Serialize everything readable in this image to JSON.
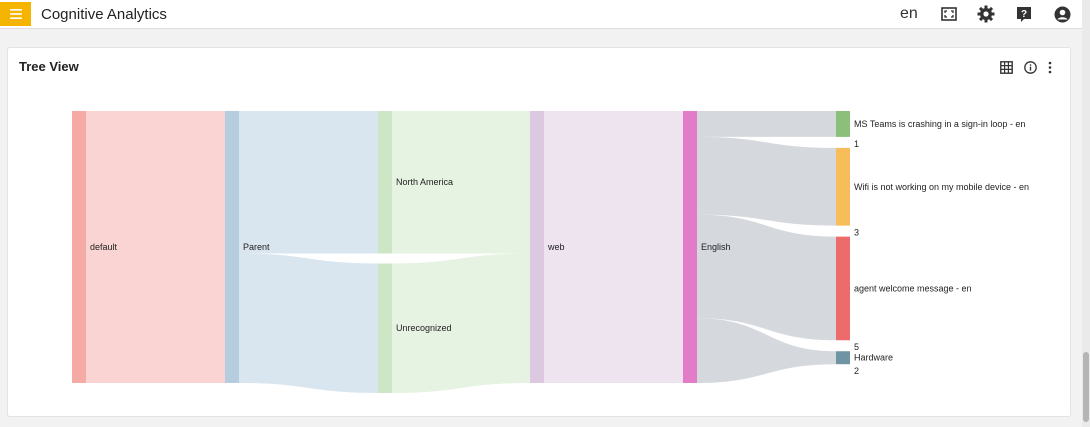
{
  "header": {
    "app_title": "Cognitive Analytics",
    "language": "en",
    "icons": [
      "menu-icon",
      "fullscreen-icon",
      "settings-icon",
      "help-icon",
      "account-icon"
    ],
    "accent_color": "#f5b400"
  },
  "card": {
    "title": "Tree View",
    "icons": [
      "table-icon",
      "info-icon",
      "more-vertical-icon"
    ]
  },
  "chart_data": {
    "type": "sankey",
    "title": "Tree View",
    "columns": [
      [
        {
          "id": "default",
          "label": "default",
          "value": 21,
          "color": "#f4aaa5"
        }
      ],
      [
        {
          "id": "parent",
          "label": "Parent",
          "value": 21,
          "color": "#b6cde0"
        }
      ],
      [
        {
          "id": "na",
          "label": "North America",
          "value": 11,
          "color": "#cde6c6"
        },
        {
          "id": "unrec",
          "label": "Unrecognized",
          "value": 10,
          "color": "#cde6c6"
        }
      ],
      [
        {
          "id": "web",
          "label": "web",
          "value": 21,
          "color": "#dcc9e1"
        }
      ],
      [
        {
          "id": "english",
          "label": "English",
          "value": 21,
          "color": "#e27cc8"
        }
      ],
      [
        {
          "id": "ms",
          "label": "MS Teams is crashing in a sign-in loop - en",
          "value_label": "1",
          "value": 2,
          "color": "#8cbf7a"
        },
        {
          "id": "wifi",
          "label": "Wifi is not working on my mobile device - en",
          "value_label": "3",
          "value": 6,
          "color": "#f6bd5a"
        },
        {
          "id": "agent",
          "label": "agent welcome message - en",
          "value_label": "5",
          "value": 8,
          "color": "#ee6b6b"
        },
        {
          "id": "hw",
          "label": "Hardware",
          "value_label": "2",
          "value": 1,
          "color": "#6f95a3"
        }
      ]
    ],
    "links": [
      {
        "source": "default",
        "target": "parent",
        "value": 21,
        "color": "#f4aaa5"
      },
      {
        "source": "parent",
        "target": "na",
        "value": 11,
        "color": "#b6cde0"
      },
      {
        "source": "parent",
        "target": "unrec",
        "value": 10,
        "color": "#b6cde0"
      },
      {
        "source": "na",
        "target": "web",
        "value": 11,
        "color": "#cde6c6"
      },
      {
        "source": "unrec",
        "target": "web",
        "value": 10,
        "color": "#cde6c6"
      },
      {
        "source": "web",
        "target": "english",
        "value": 21,
        "color": "#dcc9e1"
      },
      {
        "source": "english",
        "target": "ms",
        "value": 2,
        "color": "#9aa3ad"
      },
      {
        "source": "english",
        "target": "wifi",
        "value": 6,
        "color": "#9aa3ad"
      },
      {
        "source": "english",
        "target": "agent",
        "value": 8,
        "color": "#9aa3ad"
      },
      {
        "source": "english",
        "target": "hw",
        "value": 5,
        "color": "#9aa3ad"
      }
    ]
  }
}
